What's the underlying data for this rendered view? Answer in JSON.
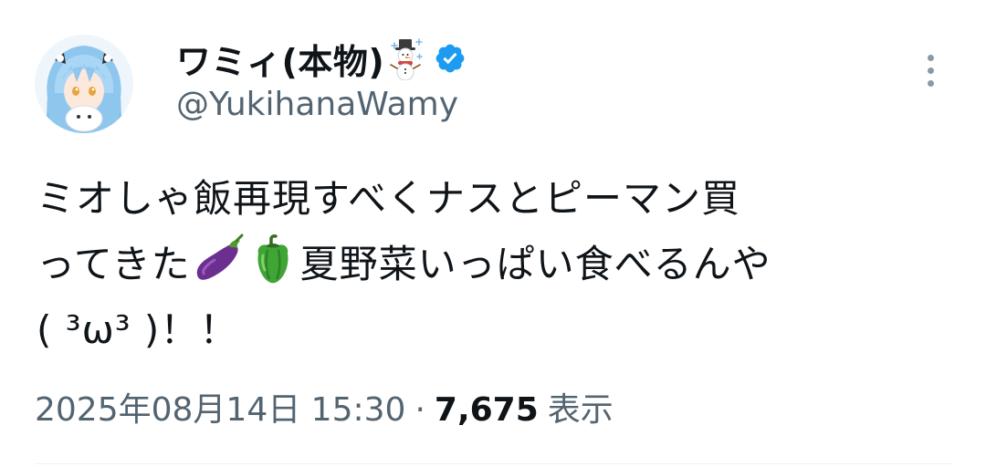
{
  "tweet": {
    "display_name": "ワミィ(本物)",
    "name_emoji": "snowman-icon",
    "verified": true,
    "handle": "@YukihanaWamy",
    "text_lines": [
      "ミオしゃ飯再現すべくナスとピーマン買",
      {
        "before": "ってきた",
        "emojis": [
          "eggplant-icon",
          "bell-pepper-icon"
        ],
        "after": "夏野菜いっぱい食べるんや"
      },
      "( ³ω³ )！！"
    ],
    "timestamp": "2025年08月14日 15:30",
    "separator": "·",
    "views_count": "7,675",
    "views_label": "表示"
  },
  "colors": {
    "text_primary": "#0f1419",
    "text_secondary": "#536471",
    "verified_blue": "#1d9bf0",
    "divider": "#eff3f4"
  }
}
